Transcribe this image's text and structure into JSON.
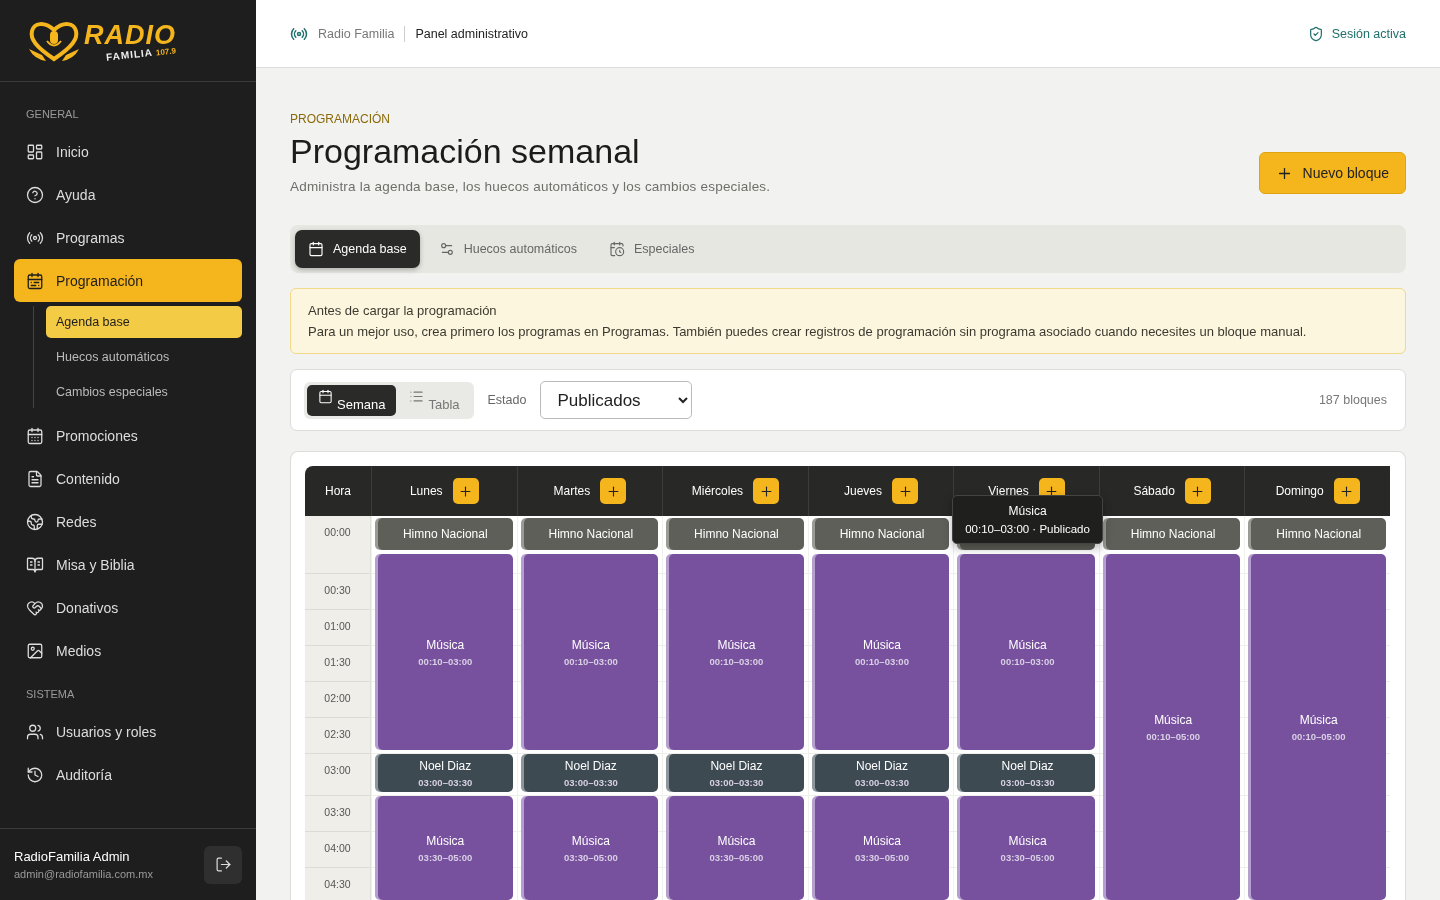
{
  "logo": {
    "word": "RADIO",
    "sub": "FAMILIA",
    "freq": "107.9"
  },
  "sidebar": {
    "sections": [
      {
        "title": "GENERAL",
        "items": [
          {
            "label": "Inicio",
            "selected": false
          },
          {
            "label": "Ayuda",
            "selected": false
          },
          {
            "label": "Programas",
            "selected": false
          },
          {
            "label": "Programación",
            "selected": true,
            "children": [
              {
                "label": "Agenda base",
                "selected": true
              },
              {
                "label": "Huecos automáticos",
                "selected": false
              },
              {
                "label": "Cambios especiales",
                "selected": false
              }
            ]
          },
          {
            "label": "Promociones",
            "selected": false
          },
          {
            "label": "Contenido",
            "selected": false
          },
          {
            "label": "Redes",
            "selected": false
          },
          {
            "label": "Misa y Biblia",
            "selected": false
          },
          {
            "label": "Donativos",
            "selected": false
          },
          {
            "label": "Medios",
            "selected": false
          }
        ]
      },
      {
        "title": "SISTEMA",
        "items": [
          {
            "label": "Usuarios y roles",
            "selected": false
          },
          {
            "label": "Auditoría",
            "selected": false
          }
        ]
      }
    ],
    "user": {
      "name": "RadioFamilia Admin",
      "email": "admin@radiofamilia.com.mx"
    }
  },
  "topbar": {
    "brand": "Radio Familia",
    "title": "Panel administrativo",
    "session": "Sesión activa"
  },
  "page": {
    "eyebrow": "PROGRAMACIÓN",
    "title": "Programación semanal",
    "subtitle": "Administra la agenda base, los huecos automáticos y los cambios especiales.",
    "action": "Nuevo bloque"
  },
  "tabs": [
    {
      "label": "Agenda base",
      "selected": true
    },
    {
      "label": "Huecos automáticos",
      "selected": false
    },
    {
      "label": "Especiales",
      "selected": false
    }
  ],
  "notice": {
    "title": "Antes de cargar la programación",
    "text": "Para un mejor uso, crea primero los programas en Programas. También puedes crear registros de programación sin programa asociado cuando necesites un bloque manual."
  },
  "toolbar": {
    "views": [
      {
        "label": "Semana",
        "selected": true
      },
      {
        "label": "Tabla",
        "selected": false
      }
    ],
    "filter_label": "Estado",
    "filter_value": "Publicados",
    "count": "187 bloques"
  },
  "calendar": {
    "hour_header": "Hora",
    "times": [
      "00:00",
      "00:30",
      "01:00",
      "01:30",
      "02:00",
      "02:30",
      "03:00",
      "03:30",
      "04:00",
      "04:30"
    ],
    "days": [
      {
        "name": "Lunes",
        "blocks": [
          {
            "kind": "anthem",
            "title": "Himno Nacional"
          },
          {
            "kind": "music",
            "title": "Música",
            "time": "00:10–03:00"
          },
          {
            "kind": "program",
            "title": "Noel Diaz",
            "time": "03:00–03:30"
          },
          {
            "kind": "music",
            "title": "Música",
            "time": "03:30–05:00"
          }
        ]
      },
      {
        "name": "Martes",
        "blocks": [
          {
            "kind": "anthem",
            "title": "Himno Nacional"
          },
          {
            "kind": "music",
            "title": "Música",
            "time": "00:10–03:00"
          },
          {
            "kind": "program",
            "title": "Noel Diaz",
            "time": "03:00–03:30"
          },
          {
            "kind": "music",
            "title": "Música",
            "time": "03:30–05:00"
          }
        ]
      },
      {
        "name": "Miércoles",
        "blocks": [
          {
            "kind": "anthem",
            "title": "Himno Nacional"
          },
          {
            "kind": "music",
            "title": "Música",
            "time": "00:10–03:00"
          },
          {
            "kind": "program",
            "title": "Noel Diaz",
            "time": "03:00–03:30"
          },
          {
            "kind": "music",
            "title": "Música",
            "time": "03:30–05:00"
          }
        ]
      },
      {
        "name": "Jueves",
        "blocks": [
          {
            "kind": "anthem",
            "title": "Himno Nacional"
          },
          {
            "kind": "music",
            "title": "Música",
            "time": "00:10–03:00"
          },
          {
            "kind": "program",
            "title": "Noel Diaz",
            "time": "03:00–03:30"
          },
          {
            "kind": "music",
            "title": "Música",
            "time": "03:30–05:00"
          }
        ]
      },
      {
        "name": "Viernes",
        "tooltip": {
          "title": "Música",
          "detail": "00:10–03:00 · Publicado"
        },
        "blocks": [
          {
            "kind": "anthem"
          },
          {
            "kind": "music",
            "title": "Música",
            "time": "00:10–03:00"
          },
          {
            "kind": "program",
            "title": "Noel Diaz",
            "time": "03:00–03:30"
          },
          {
            "kind": "music",
            "title": "Música",
            "time": "03:30–05:00"
          }
        ]
      },
      {
        "name": "Sábado",
        "blocks": [
          {
            "kind": "anthem",
            "title": "Himno Nacional"
          },
          {
            "kind": "music",
            "title": "Música",
            "time": "00:10–05:00"
          }
        ]
      },
      {
        "name": "Domingo",
        "blocks": [
          {
            "kind": "anthem",
            "title": "Himno Nacional"
          },
          {
            "kind": "music",
            "title": "Música",
            "time": "00:10–05:00"
          }
        ]
      }
    ]
  }
}
